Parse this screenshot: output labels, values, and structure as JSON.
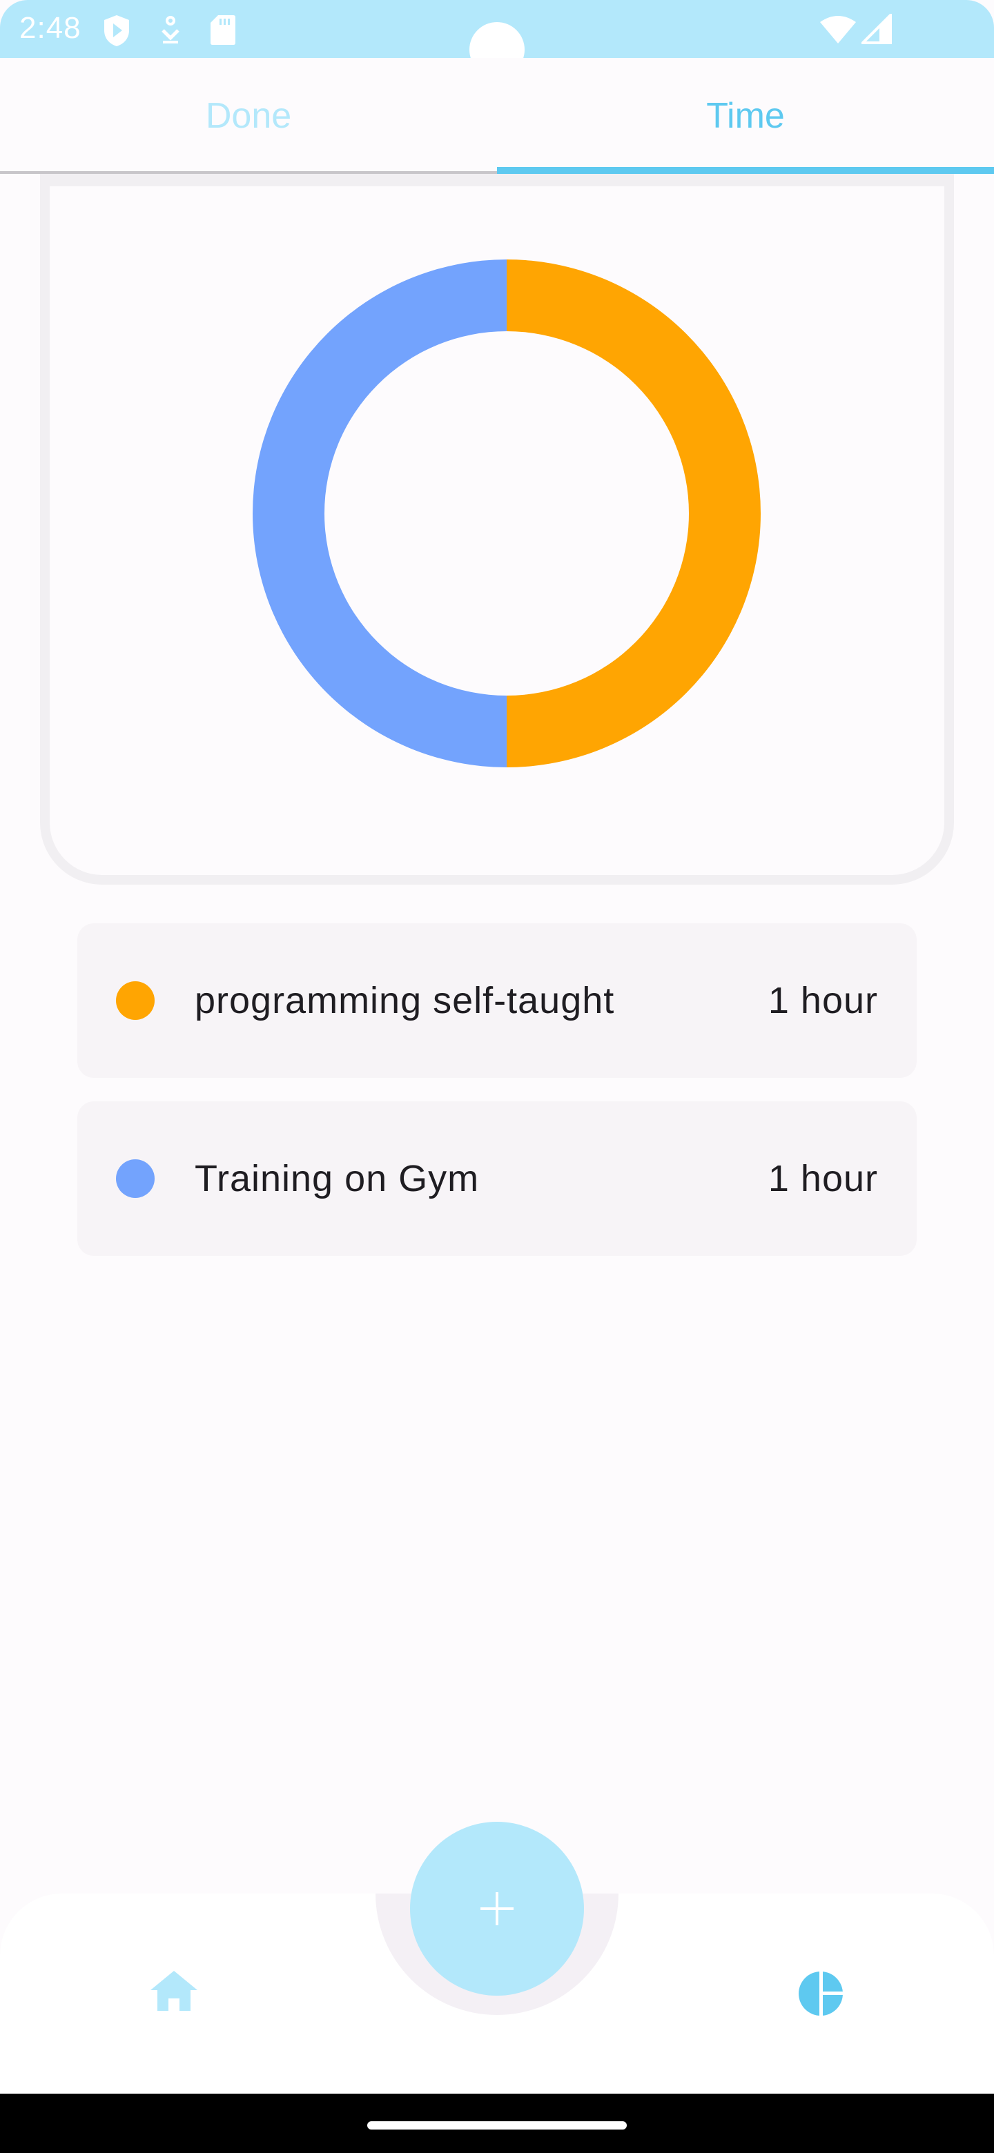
{
  "status_bar": {
    "time": "2:48",
    "icons": [
      "shield-play-icon",
      "download-icon",
      "sd-card-icon",
      "wifi-icon",
      "cellular-signal-icon"
    ],
    "background_color": "#b3e8fb"
  },
  "tabs": [
    {
      "label": "Done",
      "selected": false
    },
    {
      "label": "Time",
      "selected": true
    }
  ],
  "accent_color": "#5ec9f0",
  "chart_data": {
    "type": "pie",
    "variant": "donut",
    "categories": [
      "programming self-taught",
      "Training on Gym"
    ],
    "values": [
      1,
      1
    ],
    "units": "hour",
    "colors": [
      "#ffa502",
      "#73a3fd"
    ]
  },
  "legend": [
    {
      "label": "programming self-taught",
      "value": "1 hour",
      "color": "#ffa502"
    },
    {
      "label": "Training on Gym",
      "value": "1 hour",
      "color": "#73a3fd"
    }
  ],
  "bottom_nav": {
    "items": [
      {
        "icon": "home-icon",
        "selected": false
      },
      {
        "icon": "pie-chart-icon",
        "selected": true
      }
    ],
    "fab": {
      "icon": "plus-icon"
    }
  }
}
